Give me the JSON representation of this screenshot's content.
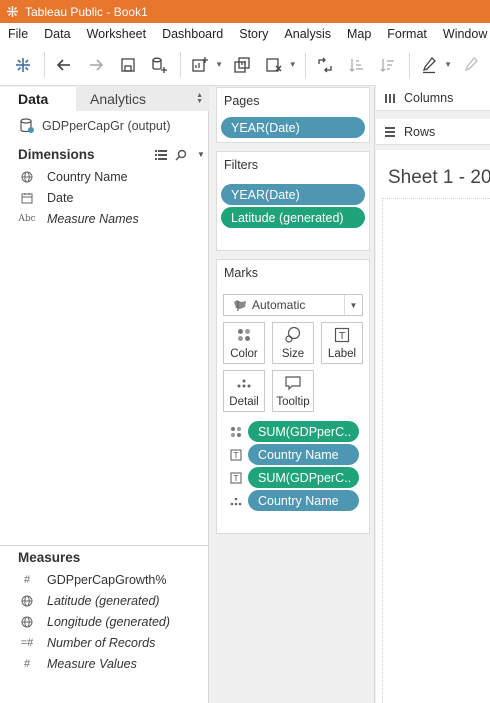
{
  "window": {
    "title": "Tableau Public - Book1"
  },
  "menu": [
    "File",
    "Data",
    "Worksheet",
    "Dashboard",
    "Story",
    "Analysis",
    "Map",
    "Format",
    "Window",
    "H"
  ],
  "data_pane": {
    "tabs": {
      "data": "Data",
      "analytics": "Analytics"
    },
    "datasource": "GDPperCapGr (output)",
    "dimensions_header": "Dimensions",
    "dimensions": [
      {
        "label": "Country Name",
        "icon": "globe-icon"
      },
      {
        "label": "Date",
        "icon": "calendar-icon"
      },
      {
        "label": "Measure Names",
        "icon": "abc-icon"
      }
    ],
    "measures_header": "Measures",
    "measures": [
      {
        "label": "GDPperCapGrowth%",
        "icon": "hash-icon"
      },
      {
        "label": "Latitude (generated)",
        "icon": "globe-icon"
      },
      {
        "label": "Longitude (generated)",
        "icon": "globe-icon"
      },
      {
        "label": "Number of Records",
        "icon": "hash-icon"
      },
      {
        "label": "Measure Values",
        "icon": "hash-icon"
      }
    ]
  },
  "pages": {
    "title": "Pages",
    "pill": "YEAR(Date)"
  },
  "filters": {
    "title": "Filters",
    "pills": [
      "YEAR(Date)",
      "Latitude (generated)"
    ]
  },
  "marks": {
    "title": "Marks",
    "type": "Automatic",
    "buttons": {
      "color": "Color",
      "size": "Size",
      "label": "Label",
      "detail": "Detail",
      "tooltip": "Tooltip"
    },
    "fields": [
      "SUM(GDPperC..",
      "Country Name",
      "SUM(GDPperC..",
      "Country Name"
    ]
  },
  "shelves": {
    "columns": "Columns",
    "rows": "Rows"
  },
  "sheet": {
    "title": "Sheet 1 - 20"
  },
  "colors": {
    "titlebar": "#e8762d",
    "green_pill": "#1fa37a",
    "blue_pill": "#4e97b3"
  }
}
